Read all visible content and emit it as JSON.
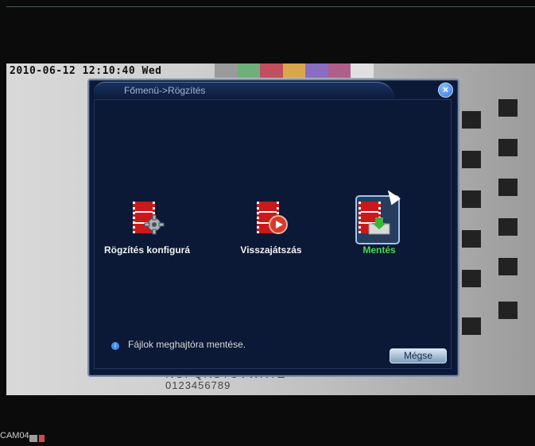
{
  "overlay": {
    "timestamp": "2010-06-12 12:10:40 Wed",
    "camera_label": "CAM04"
  },
  "background_text": {
    "line1": "NOPQRSTUVWXYZ",
    "line2": "0123456789"
  },
  "dialog": {
    "title": "Főmenü->Rögzítés",
    "items": [
      {
        "label": "Rögzítés konfigurá",
        "icon": "record-config-gear-icon",
        "selected": false
      },
      {
        "label": "Visszajátszás",
        "icon": "playback-icon",
        "selected": false
      },
      {
        "label": "Mentés",
        "icon": "backup-icon",
        "selected": true
      }
    ],
    "hint": "Fájlok meghajtóra mentése.",
    "cancel_label": "Mégse"
  },
  "colors": {
    "dialog_bg": "#0b1937",
    "selected_label": "#4cd64c",
    "accent": "#3f8fe8"
  }
}
